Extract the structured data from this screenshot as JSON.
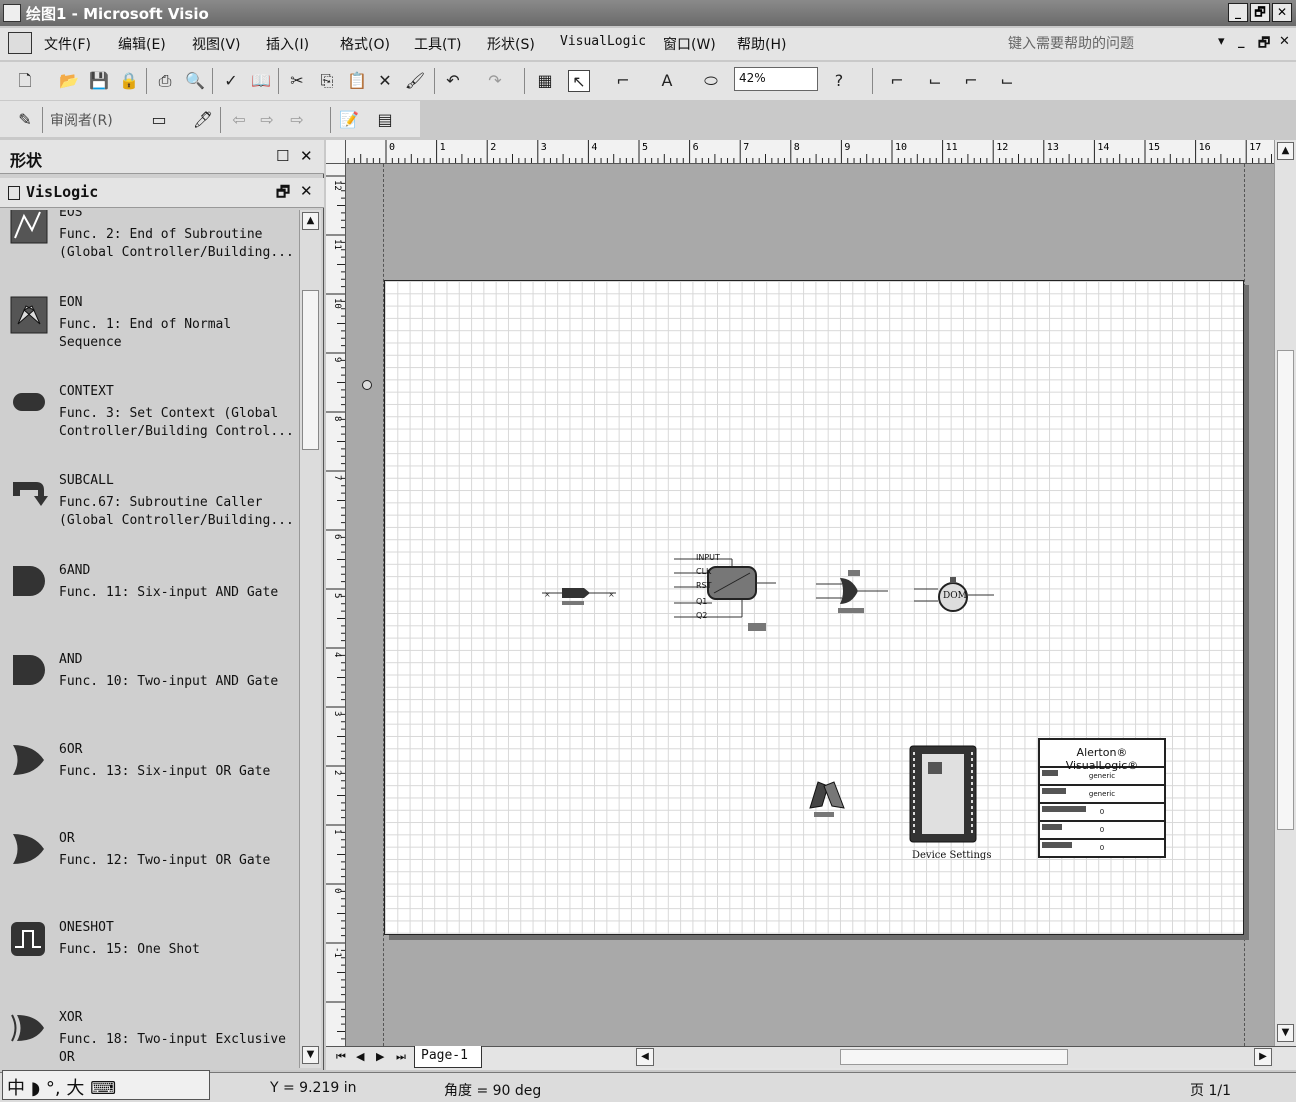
{
  "window": {
    "title": "绘图1 - Microsoft Visio",
    "buttons": [
      "_",
      "🗗",
      "✕"
    ]
  },
  "menu": {
    "items": [
      "文件(F)",
      "编辑(E)",
      "视图(V)",
      "插入(I)",
      "格式(O)",
      "工具(T)",
      "形状(S)",
      "VisualLogic",
      "窗口(W)",
      "帮助(H)"
    ],
    "help_placeholder": "键入需要帮助的问题",
    "mdi_buttons": [
      "▾",
      "_",
      "🗗",
      "✕"
    ]
  },
  "toolbar": {
    "zoom": "42%",
    "reviewer": "审阅者(R)"
  },
  "shapes_panel": {
    "title": "形状",
    "stencil_title": "VisLogic",
    "items": [
      {
        "name": "EOS",
        "desc": "Func. 2: End of Subroutine (Global Controller/Building...",
        "icon": "eos-icon"
      },
      {
        "name": "EON",
        "desc": "Func. 1: End of Normal Sequence",
        "icon": "checkered-flags-icon"
      },
      {
        "name": "CONTEXT",
        "desc": "Func. 3: Set Context (Global Controller/Building Control...",
        "icon": "context-icon"
      },
      {
        "name": "SUBCALL",
        "desc": "Func.67: Subroutine Caller (Global Controller/Building...",
        "icon": "subcall-icon"
      },
      {
        "name": "6AND",
        "desc": "Func. 11: Six-input AND Gate",
        "icon": "and-gate-icon"
      },
      {
        "name": "AND",
        "desc": "Func. 10: Two-input AND Gate",
        "icon": "and-gate-icon"
      },
      {
        "name": "6OR",
        "desc": "Func. 13: Six-input OR Gate",
        "icon": "or-gate-icon"
      },
      {
        "name": "OR",
        "desc": "Func. 12: Two-input OR Gate",
        "icon": "or-gate-icon"
      },
      {
        "name": "ONESHOT",
        "desc": "Func. 15: One Shot",
        "icon": "oneshot-icon"
      },
      {
        "name": "XOR",
        "desc": "Func. 18: Two-input Exclusive OR",
        "icon": "xor-gate-icon"
      }
    ]
  },
  "rulers": {
    "horizontal": [
      "0",
      "1",
      "2",
      "3",
      "4",
      "5",
      "6",
      "7",
      "8",
      "9",
      "10",
      "11",
      "12",
      "13",
      "14",
      "15",
      "16",
      "17"
    ],
    "vertical": [
      "12",
      "11",
      "10",
      "9",
      "8",
      "7",
      "6",
      "5",
      "4",
      "3",
      "2",
      "1",
      "0",
      "-1"
    ]
  },
  "canvas": {
    "input_labels": [
      "INPUT",
      "CLK",
      "RST",
      "Q1",
      "Q2"
    ],
    "dom_label": "DOM",
    "device_label": "Device Settings",
    "alerton": {
      "title": "Alerton® VisualLogic®",
      "rows": [
        "generic",
        "generic",
        "0",
        "0",
        "0"
      ]
    }
  },
  "page_tab": "Page-1",
  "status": {
    "y": "Y = 9.219 in",
    "angle": "角度 = 90 deg",
    "page": "页 1/1"
  },
  "ime": "中 ◗ °, 大 ⌨"
}
